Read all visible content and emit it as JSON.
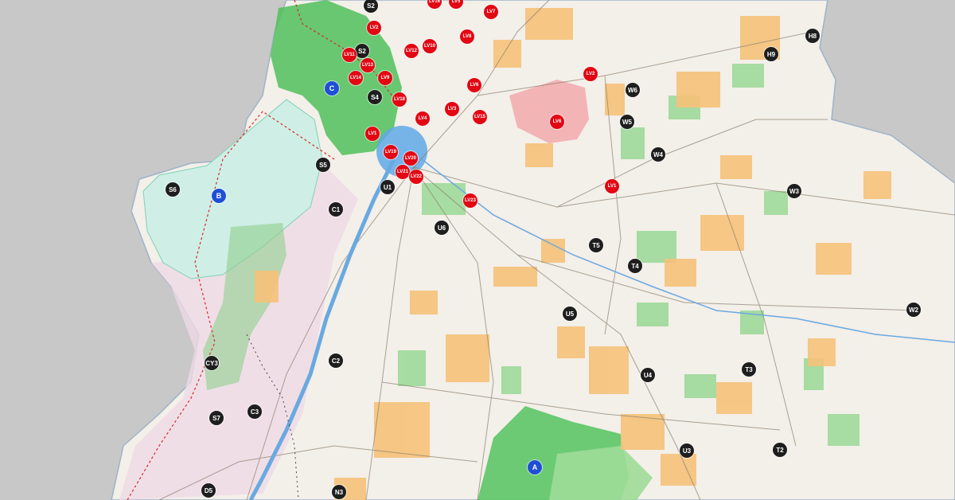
{
  "colors": {
    "background": "#c8c8c8",
    "land": "#f3efe9",
    "green": "#9ed99a",
    "dark_green": "#49b84e",
    "orange": "#f6c27a",
    "river": "#6aa9e0",
    "red_marker": "#e30613",
    "black_marker": "#1e1e1e",
    "blue_marker": "#1f4fd6"
  },
  "markers": [
    {
      "label": "S2",
      "type": "black"
    },
    {
      "label": "S2",
      "type": "black"
    },
    {
      "label": "S4",
      "type": "black"
    },
    {
      "label": "S5",
      "type": "black"
    },
    {
      "label": "S6",
      "type": "black"
    },
    {
      "label": "S7",
      "type": "black"
    },
    {
      "label": "C1",
      "type": "black"
    },
    {
      "label": "C2",
      "type": "black"
    },
    {
      "label": "C3",
      "type": "black"
    },
    {
      "label": "CY3",
      "type": "black"
    },
    {
      "label": "D5",
      "type": "black"
    },
    {
      "label": "N3",
      "type": "black"
    },
    {
      "label": "U1",
      "type": "black"
    },
    {
      "label": "U3",
      "type": "black"
    },
    {
      "label": "U4",
      "type": "black"
    },
    {
      "label": "U5",
      "type": "black"
    },
    {
      "label": "U6",
      "type": "black"
    },
    {
      "label": "T2",
      "type": "black"
    },
    {
      "label": "T3",
      "type": "black"
    },
    {
      "label": "T4",
      "type": "black"
    },
    {
      "label": "T5",
      "type": "black"
    },
    {
      "label": "W2",
      "type": "black"
    },
    {
      "label": "W3",
      "type": "black"
    },
    {
      "label": "W4",
      "type": "black"
    },
    {
      "label": "W5",
      "type": "black"
    },
    {
      "label": "W6",
      "type": "black"
    },
    {
      "label": "H8",
      "type": "black"
    },
    {
      "label": "H9",
      "type": "black"
    },
    {
      "label": "A",
      "type": "blue"
    },
    {
      "label": "B",
      "type": "blue"
    },
    {
      "label": "C",
      "type": "blue"
    },
    {
      "label": "LV16",
      "type": "red"
    },
    {
      "label": "LV5",
      "type": "red"
    },
    {
      "label": "LV7",
      "type": "red"
    },
    {
      "label": "LV8",
      "type": "red"
    },
    {
      "label": "LV10",
      "type": "red"
    },
    {
      "label": "LV12",
      "type": "red"
    },
    {
      "label": "LV11",
      "type": "red"
    },
    {
      "label": "LV13",
      "type": "red"
    },
    {
      "label": "LV14",
      "type": "red"
    },
    {
      "label": "LV9",
      "type": "red"
    },
    {
      "label": "LV6",
      "type": "red"
    },
    {
      "label": "LV18",
      "type": "red"
    },
    {
      "label": "LV3",
      "type": "red"
    },
    {
      "label": "LV15",
      "type": "red"
    },
    {
      "label": "LV4",
      "type": "red"
    },
    {
      "label": "LV2",
      "type": "red"
    },
    {
      "label": "LV6",
      "type": "red"
    },
    {
      "label": "LV1",
      "type": "red"
    },
    {
      "label": "LV19",
      "type": "red"
    },
    {
      "label": "LV20",
      "type": "red"
    },
    {
      "label": "LV21",
      "type": "red"
    },
    {
      "label": "LV22",
      "type": "red"
    },
    {
      "label": "LV23",
      "type": "red"
    },
    {
      "label": "LV1",
      "type": "red"
    },
    {
      "label": "LV2",
      "type": "red"
    },
    {
      "label": "LV17",
      "type": "red"
    }
  ]
}
